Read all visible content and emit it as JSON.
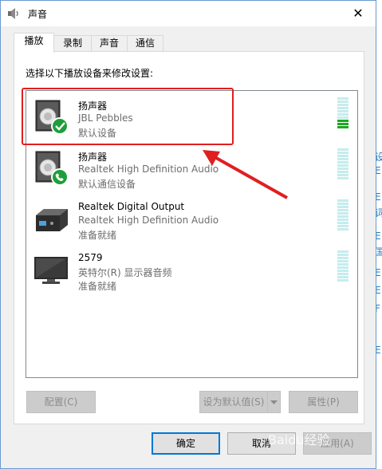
{
  "window": {
    "title": "声音",
    "close_glyph": "✕"
  },
  "tabs": [
    {
      "label": "播放"
    },
    {
      "label": "录制"
    },
    {
      "label": "声音"
    },
    {
      "label": "通信"
    }
  ],
  "instruction": "选择以下播放设备来修改设置:",
  "devices": [
    {
      "name": "扬声器",
      "description": "JBL Pebbles",
      "status": "默认设备",
      "icon": "speaker-default-icon",
      "meter_level": 0.15
    },
    {
      "name": "扬声器",
      "description": "Realtek High Definition Audio",
      "status": "默认通信设备",
      "icon": "speaker-communication-icon",
      "meter_level": 0
    },
    {
      "name": "Realtek Digital Output",
      "description": "Realtek High Definition Audio",
      "status": "准备就绪",
      "icon": "digital-output-icon",
      "meter_level": 0
    },
    {
      "name": "2579",
      "description": "英特尔(R) 显示器音频",
      "status": "准备就绪",
      "icon": "monitor-icon",
      "meter_level": 0
    }
  ],
  "buttons": {
    "configure": "配置(C)",
    "set_default": "设为默认值(S)",
    "properties": "属性(P)",
    "ok": "确定",
    "cancel": "取消",
    "apply": "应用(A)"
  },
  "background_window": {
    "chars": [
      "设",
      "E",
      "E",
      "词",
      "E",
      "国",
      "E",
      "E",
      "F",
      "E"
    ]
  },
  "watermark": "Baidu经验",
  "colors": {
    "accent": "#0078d7",
    "highlight": "#e01f1f",
    "meter_active": "#1fa81f",
    "meter_idle": "#c6ecec"
  }
}
